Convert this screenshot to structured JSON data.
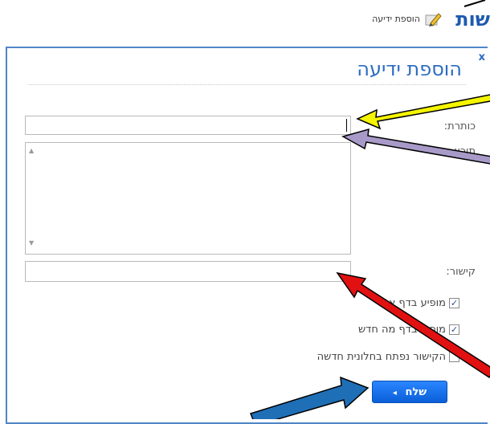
{
  "header": {
    "brand_fragment": "שות",
    "add_link": "הוספת ידיעה"
  },
  "dialog": {
    "close": "x",
    "title": "הוספת ידיעה",
    "labels": {
      "title": "כותרת:",
      "content": "תוכן:",
      "link": "קישור:"
    },
    "fields": {
      "title_value": "",
      "content_value": "",
      "link_value": ""
    },
    "checkboxes": [
      {
        "label": "מופיע בדף אישי",
        "checked": true
      },
      {
        "label": "מופיע בדף מה חדש",
        "checked": true
      },
      {
        "label": "הקישור נפתח בחלונית חדשה",
        "checked": false
      }
    ],
    "submit_label": "שלח",
    "submit_arrow": "◂"
  },
  "annotation_colors": {
    "yellow": "#f5f500",
    "purple": "#a89ac8",
    "red": "#e21111",
    "blue": "#1f6fb6"
  },
  "icons": [
    "pencil-icon",
    "close-icon",
    "scroll-up-icon",
    "scroll-down-icon",
    "check-icon"
  ]
}
